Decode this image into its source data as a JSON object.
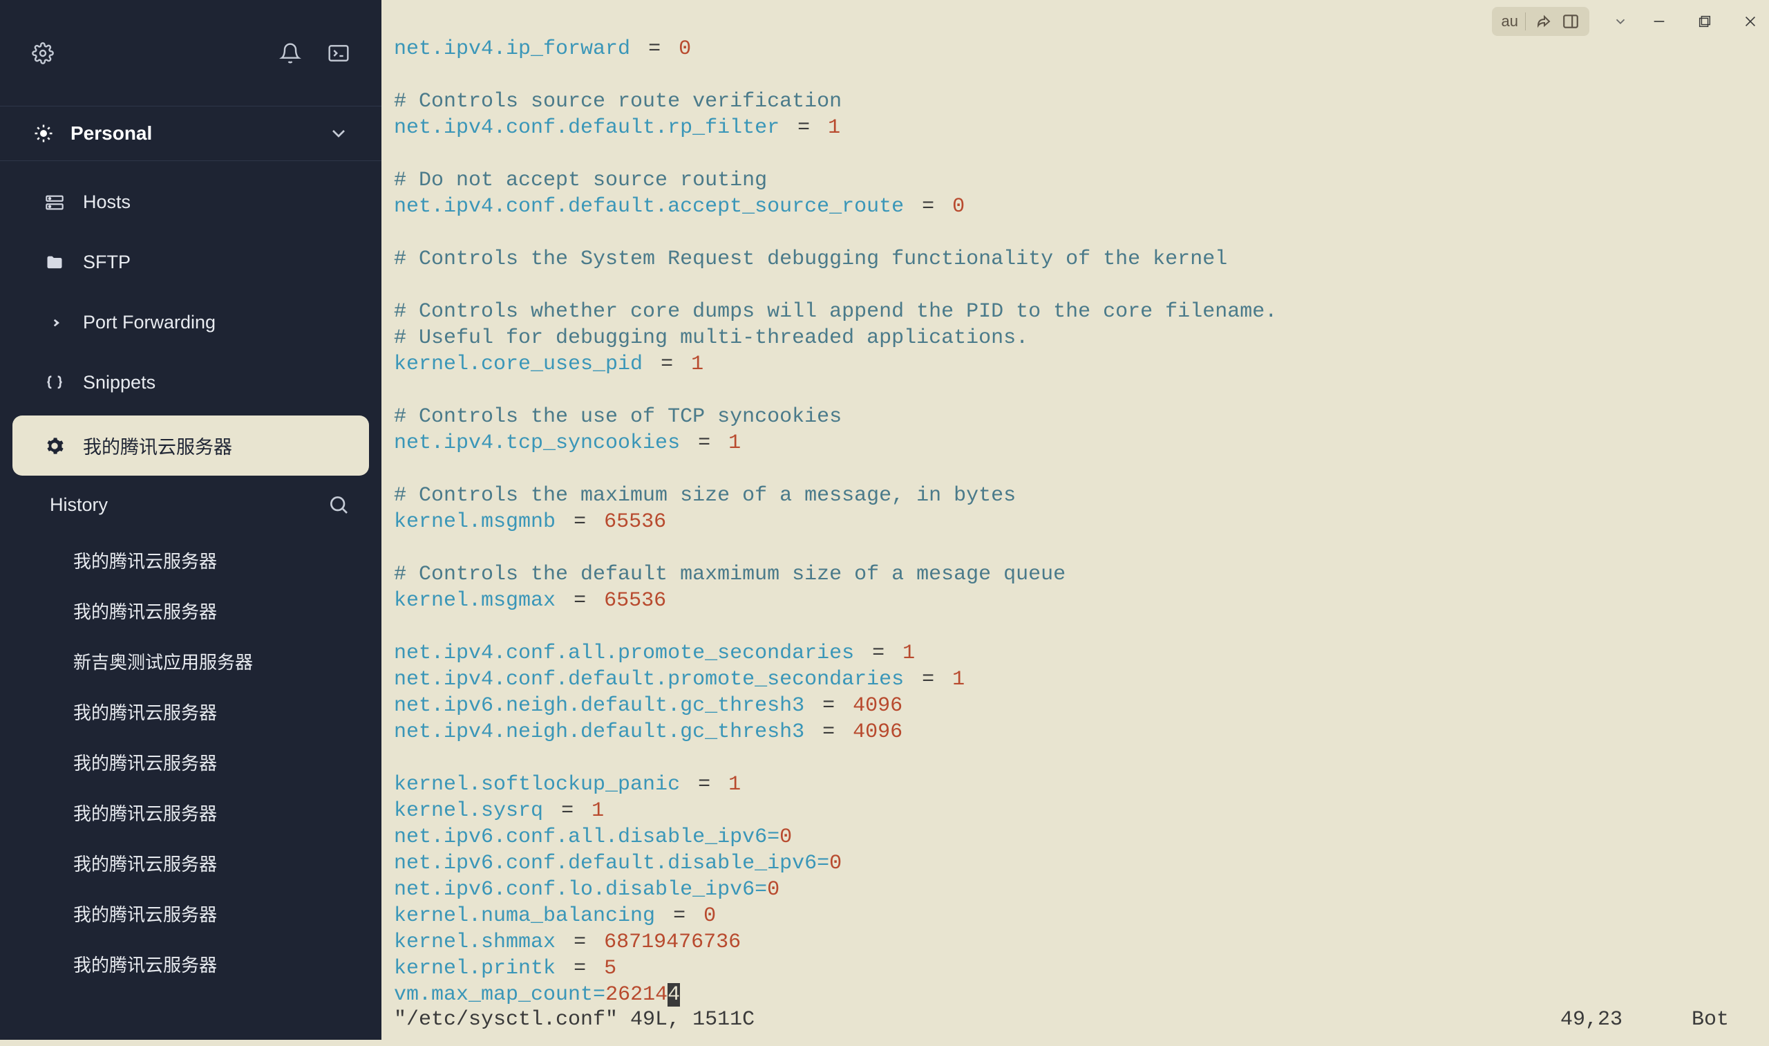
{
  "workspace": {
    "label": "Personal"
  },
  "nav": {
    "hosts": "Hosts",
    "sftp": "SFTP",
    "pf": "Port Forwarding",
    "snippets": "Snippets",
    "tencent": "我的腾讯云服务器",
    "history": "History"
  },
  "history_items": [
    "我的腾讯云服务器",
    "我的腾讯云服务器",
    "新吉奥测试应用服务器",
    "我的腾讯云服务器",
    "我的腾讯云服务器",
    "我的腾讯云服务器",
    "我的腾讯云服务器",
    "我的腾讯云服务器",
    "我的腾讯云服务器"
  ],
  "top": {
    "au": "au"
  },
  "term": {
    "lines": [
      {
        "type": "kv",
        "key": "net.ipv4.ip_forward",
        "val": "0"
      },
      {
        "type": "blank"
      },
      {
        "type": "comment",
        "text": "# Controls source route verification"
      },
      {
        "type": "kv",
        "key": "net.ipv4.conf.default.rp_filter",
        "val": "1"
      },
      {
        "type": "blank"
      },
      {
        "type": "comment",
        "text": "# Do not accept source routing"
      },
      {
        "type": "kv",
        "key": "net.ipv4.conf.default.accept_source_route",
        "val": "0"
      },
      {
        "type": "blank"
      },
      {
        "type": "comment",
        "text": "# Controls the System Request debugging functionality of the kernel"
      },
      {
        "type": "blank"
      },
      {
        "type": "comment",
        "text": "# Controls whether core dumps will append the PID to the core filename."
      },
      {
        "type": "comment",
        "text": "# Useful for debugging multi-threaded applications."
      },
      {
        "type": "kv",
        "key": "kernel.core_uses_pid",
        "val": "1"
      },
      {
        "type": "blank"
      },
      {
        "type": "comment",
        "text": "# Controls the use of TCP syncookies"
      },
      {
        "type": "kv",
        "key": "net.ipv4.tcp_syncookies",
        "val": "1"
      },
      {
        "type": "blank"
      },
      {
        "type": "comment",
        "text": "# Controls the maximum size of a message, in bytes"
      },
      {
        "type": "kv",
        "key": "kernel.msgmnb",
        "val": "65536"
      },
      {
        "type": "blank"
      },
      {
        "type": "comment",
        "text": "# Controls the default maxmimum size of a mesage queue"
      },
      {
        "type": "kv",
        "key": "kernel.msgmax",
        "val": "65536"
      },
      {
        "type": "blank"
      },
      {
        "type": "kv",
        "key": "net.ipv4.conf.all.promote_secondaries",
        "val": "1"
      },
      {
        "type": "kv",
        "key": "net.ipv4.conf.default.promote_secondaries",
        "val": "1"
      },
      {
        "type": "kv",
        "key": "net.ipv6.neigh.default.gc_thresh3",
        "val": "4096"
      },
      {
        "type": "kv",
        "key": "net.ipv4.neigh.default.gc_thresh3",
        "val": "4096"
      },
      {
        "type": "blank"
      },
      {
        "type": "kv",
        "key": "kernel.softlockup_panic",
        "val": "1"
      },
      {
        "type": "kv",
        "key": "kernel.sysrq",
        "val": "1"
      },
      {
        "type": "kvn",
        "key": "net.ipv6.conf.all.disable_ipv6",
        "val": "0"
      },
      {
        "type": "kvn",
        "key": "net.ipv6.conf.default.disable_ipv6",
        "val": "0"
      },
      {
        "type": "kvn",
        "key": "net.ipv6.conf.lo.disable_ipv6",
        "val": "0"
      },
      {
        "type": "kv",
        "key": "kernel.numa_balancing",
        "val": "0"
      },
      {
        "type": "kv",
        "key": "kernel.shmmax",
        "val": "68719476736"
      },
      {
        "type": "kv",
        "key": "kernel.printk",
        "val": "5"
      },
      {
        "type": "kvc",
        "key": "vm.max_map_count",
        "val": "26214",
        "cursor": "4"
      }
    ]
  },
  "status": {
    "left": "\"/etc/sysctl.conf\" 49L, 1511C",
    "pos": "49,23",
    "scroll": "Bot"
  }
}
